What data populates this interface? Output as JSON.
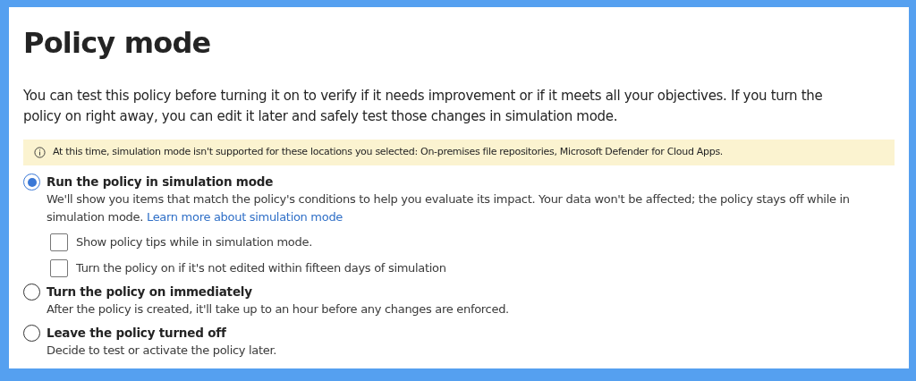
{
  "title": "Policy mode",
  "intro": "You can test this policy before turning it on to verify if it needs improvement or if it meets all your objectives. If you turn the policy on right away, you can edit it later and safely test those changes in simulation mode.",
  "notice": {
    "text": "At this time, simulation mode isn't supported for these locations you selected: On-premises file repositories, Microsoft Defender for Cloud Apps."
  },
  "options": [
    {
      "label": "Run the policy in simulation mode",
      "selected": true,
      "description": "We'll show you items that match the policy's conditions to help you evaluate its impact. Your data won't be affected; the policy stays off while in simulation mode.",
      "link": "Learn more about simulation mode",
      "checkboxes": [
        {
          "label": "Show policy tips while in simulation mode.",
          "checked": false
        },
        {
          "label": "Turn the policy on if it's not edited within fifteen days of simulation",
          "checked": false
        }
      ]
    },
    {
      "label": "Turn the policy on immediately",
      "selected": false,
      "description": "After the policy is created, it'll take up to an hour before any changes are enforced."
    },
    {
      "label": "Leave the policy turned off",
      "selected": false,
      "description": "Decide to test or activate the policy later."
    }
  ]
}
